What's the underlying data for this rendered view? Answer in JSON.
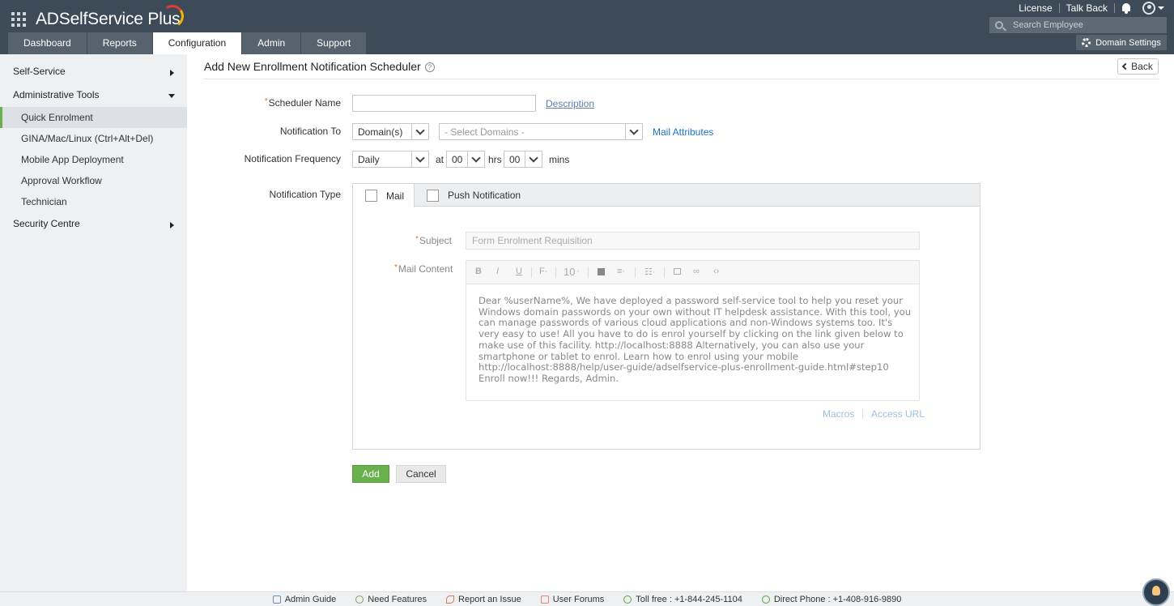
{
  "app": {
    "brand": "ADSelfService Plus"
  },
  "header": {
    "links": [
      "License",
      "Talk Back"
    ],
    "search_placeholder": "Search Employee",
    "domain_settings": "Domain Settings"
  },
  "tabs": [
    {
      "label": "Dashboard",
      "active": false
    },
    {
      "label": "Reports",
      "active": false
    },
    {
      "label": "Configuration",
      "active": true
    },
    {
      "label": "Admin",
      "active": false
    },
    {
      "label": "Support",
      "active": false
    }
  ],
  "sidebar": {
    "self_service": "Self-Service",
    "admin_tools": "Administrative Tools",
    "items": [
      "Quick Enrolment",
      "GINA/Mac/Linux (Ctrl+Alt+Del)",
      "Mobile App Deployment",
      "Approval Workflow",
      "Technician"
    ],
    "security_centre": "Security Centre"
  },
  "page": {
    "title": "Add New Enrollment Notification Scheduler",
    "back": "Back"
  },
  "form": {
    "scheduler_name_label": "Scheduler Name",
    "scheduler_name_value": "",
    "description_link": "Description",
    "notification_to_label": "Notification To",
    "notification_to_value": "Domain(s)",
    "domains_placeholder": "- Select Domains -",
    "mail_attributes_link": "Mail Attributes",
    "frequency_label": "Notification Frequency",
    "frequency_value": "Daily",
    "at_label": "at",
    "hrs_value": "00",
    "hrs_label": "hrs",
    "mins_value": "00",
    "mins_label": "mins",
    "notification_type_label": "Notification Type",
    "type_tabs": [
      "Mail",
      "Push Notification"
    ],
    "subject_label": "Subject",
    "subject_placeholder": "Form Enrolment Requisition",
    "mail_content_label": "Mail Content",
    "font_size": "10",
    "mail_content": "Dear %userName%, We have deployed a password self-service tool to help you reset your Windows domain passwords on your own without IT helpdesk assistance. With this tool, you can manage passwords of various cloud applications and non-Windows systems too. It's very easy to use! All you have to do is enrol yourself by clicking on the link given below to make use of this facility. http://localhost:8888 Alternatively, you can also use your smartphone or tablet to enrol. Learn how to enrol using your mobile http://localhost:8888/help/user-guide/adselfservice-plus-enrollment-guide.html#step10 Enroll now!!! Regards, Admin.",
    "macros_link": "Macros",
    "access_url_link": "Access URL",
    "add_button": "Add",
    "cancel_button": "Cancel"
  },
  "footer": {
    "items": [
      "Admin Guide",
      "Need Features",
      "Report an Issue",
      "User Forums",
      "Toll free : +1-844-245-1104",
      "Direct Phone : +1-408-916-9890"
    ]
  },
  "colors": {
    "header": "#3d4a57",
    "accent_green": "#6ab04c",
    "link_blue": "#1a73c8"
  }
}
